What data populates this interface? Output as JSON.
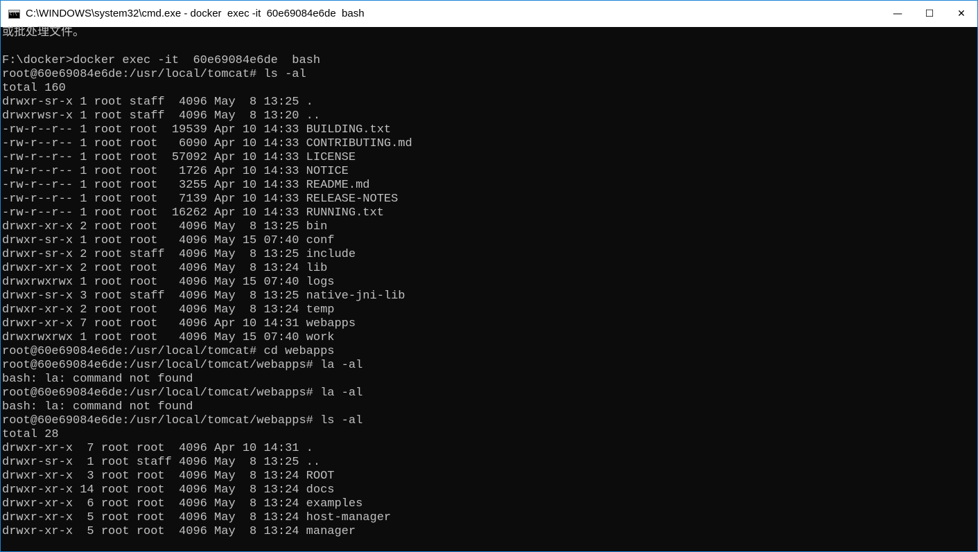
{
  "window": {
    "title": "C:\\WINDOWS\\system32\\cmd.exe - docker  exec -it  60e69084e6de  bash",
    "icon": "cmd-icon",
    "controls": {
      "minimize": "—",
      "maximize": "☐",
      "close": "✕"
    },
    "colors": {
      "background": "#0c0c0c",
      "text": "#c0c0c0",
      "border": "#1883d7"
    }
  },
  "console": {
    "lines": [
      "或批处理文件。",
      "",
      "F:\\docker>docker exec -it  60e69084e6de  bash",
      "root@60e69084e6de:/usr/local/tomcat# ls -al",
      "total 160",
      "drwxr-sr-x 1 root staff  4096 May  8 13:25 .",
      "drwxrwsr-x 1 root staff  4096 May  8 13:20 ..",
      "-rw-r--r-- 1 root root  19539 Apr 10 14:33 BUILDING.txt",
      "-rw-r--r-- 1 root root   6090 Apr 10 14:33 CONTRIBUTING.md",
      "-rw-r--r-- 1 root root  57092 Apr 10 14:33 LICENSE",
      "-rw-r--r-- 1 root root   1726 Apr 10 14:33 NOTICE",
      "-rw-r--r-- 1 root root   3255 Apr 10 14:33 README.md",
      "-rw-r--r-- 1 root root   7139 Apr 10 14:33 RELEASE-NOTES",
      "-rw-r--r-- 1 root root  16262 Apr 10 14:33 RUNNING.txt",
      "drwxr-xr-x 2 root root   4096 May  8 13:25 bin",
      "drwxr-sr-x 1 root root   4096 May 15 07:40 conf",
      "drwxr-sr-x 2 root staff  4096 May  8 13:25 include",
      "drwxr-xr-x 2 root root   4096 May  8 13:24 lib",
      "drwxrwxrwx 1 root root   4096 May 15 07:40 logs",
      "drwxr-sr-x 3 root staff  4096 May  8 13:25 native-jni-lib",
      "drwxr-xr-x 2 root root   4096 May  8 13:24 temp",
      "drwxr-xr-x 7 root root   4096 Apr 10 14:31 webapps",
      "drwxrwxrwx 1 root root   4096 May 15 07:40 work",
      "root@60e69084e6de:/usr/local/tomcat# cd webapps",
      "root@60e69084e6de:/usr/local/tomcat/webapps# la -al",
      "bash: la: command not found",
      "root@60e69084e6de:/usr/local/tomcat/webapps# la -al",
      "bash: la: command not found",
      "root@60e69084e6de:/usr/local/tomcat/webapps# ls -al",
      "total 28",
      "drwxr-xr-x  7 root root  4096 Apr 10 14:31 .",
      "drwxr-sr-x  1 root staff 4096 May  8 13:25 ..",
      "drwxr-xr-x  3 root root  4096 May  8 13:24 ROOT",
      "drwxr-xr-x 14 root root  4096 May  8 13:24 docs",
      "drwxr-xr-x  6 root root  4096 May  8 13:24 examples",
      "drwxr-xr-x  5 root root  4096 May  8 13:24 host-manager",
      "drwxr-xr-x  5 root root  4096 May  8 13:24 manager"
    ]
  }
}
